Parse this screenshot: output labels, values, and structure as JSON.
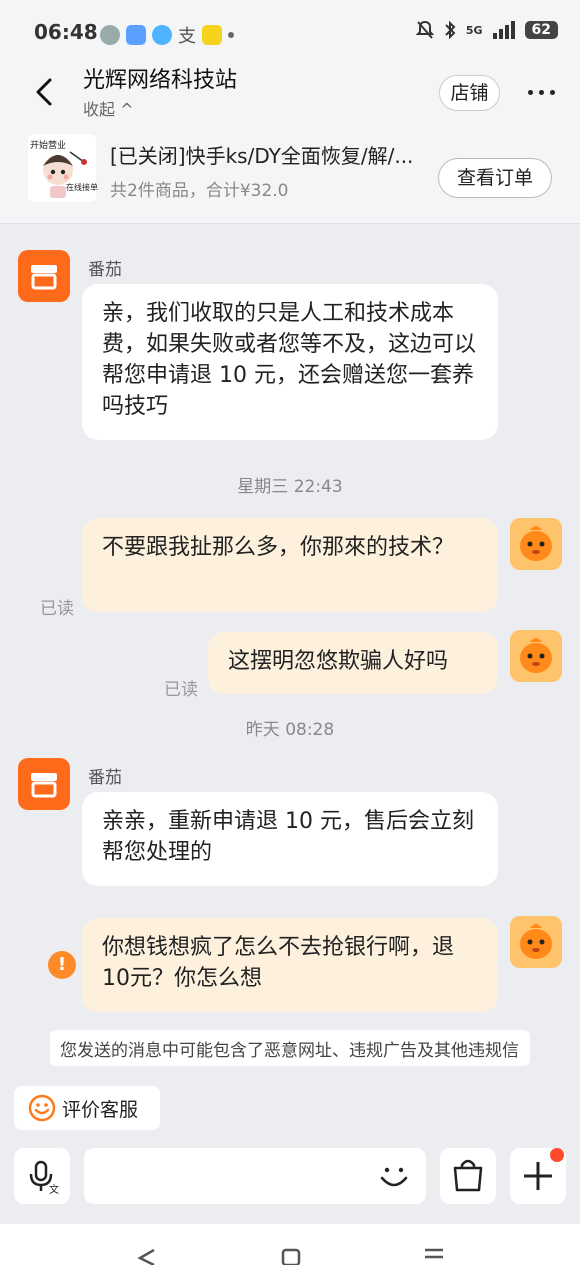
{
  "status": {
    "time": "06:48",
    "net": "5G",
    "battery": "62"
  },
  "header": {
    "title": "光辉网络科技站",
    "collapse": "收起 ^",
    "store_label": "店铺"
  },
  "order": {
    "title": "[已关闭]快手ks/DY全面恢复/解/...",
    "subtitle": "共2件商品，合计¥32.0",
    "view_label": "查看订单",
    "thumb_text_top": "开始营业",
    "thumb_text_bottom": "在线接单"
  },
  "messages": {
    "m1_sender": "番茄",
    "m1_text": "亲，我们收取的只是人工和技术成本费，如果失败或者您等不及，这边可以帮您申请退 10 元，还会赠送您一套养吗技巧",
    "ts1": "星期三 22:43",
    "m2_text": "不要跟我扯那么多，你那來的技术？",
    "m2_read": "已读",
    "m3_text": "这摆明忽悠欺骗人好吗",
    "m3_read": "已读",
    "ts2": "昨天  08:28",
    "m4_sender": "番茄",
    "m4_text": "亲亲，重新申请退 10 元，售后会立刻帮您处理的",
    "m5_text": "你想钱想疯了怎么不去抢银行啊，退10元？你怎么想",
    "notice": "您发送的消息中可能包含了恶意网址、违规广告及其他违规信息，请注意甄别并谨慎操作"
  },
  "footer": {
    "rate_label": "评价客服"
  },
  "colors": {
    "accent": "#ff6a1a",
    "bubble_right": "#fdf1de",
    "bubble_left": "#ffffff",
    "background": "#ebedf1"
  }
}
